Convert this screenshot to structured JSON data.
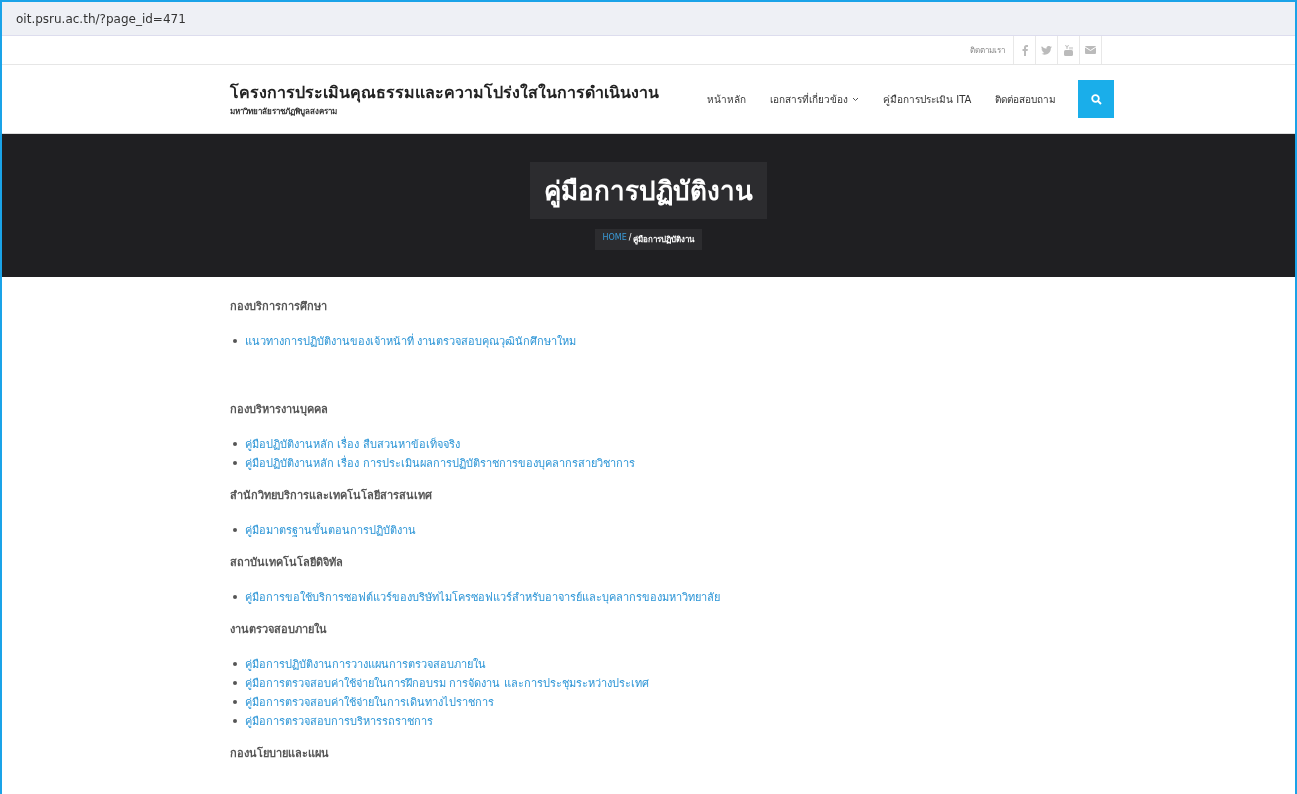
{
  "address_bar": {
    "url": "oit.psru.ac.th/?page_id=471"
  },
  "top_bar": {
    "follow_label": "ติดตามเรา"
  },
  "header": {
    "site_title": "โครงการประเมินคุณธรรมและความโปร่งใสในการดำเนินงาน",
    "site_subtitle": "มหาวิทยาลัยราชภัฏพิบูลสงคราม",
    "nav": [
      {
        "label": "หน้าหลัก",
        "dropdown": false
      },
      {
        "label": "เอกสารที่เกี่ยวข้อง",
        "dropdown": true
      },
      {
        "label": "คู่มือการประเมิน ITA",
        "dropdown": false
      },
      {
        "label": "ติดต่อสอบถาม",
        "dropdown": false
      }
    ]
  },
  "hero": {
    "title": "คู่มือการปฏิบัติงาน",
    "breadcrumb": {
      "home": "HOME",
      "separator": "/",
      "current": "คู่มือการปฏิบัติงาน"
    }
  },
  "sections": [
    {
      "heading": "กองบริการการศึกษา",
      "links": [
        "แนวทางการปฏิบัติงานของเจ้าหน้าที่ งานตรวจสอบคุณวุฒินักศึกษาใหม"
      ]
    },
    {
      "heading": "กองบริหารงานบุคคล",
      "links": [
        "คู่มือปฏิบัติงานหลัก เรื่อง สืบสวนหาข้อเท็จจริง",
        "คู่มือปฏิบัติงานหลัก เรื่อง การประเมินผลการปฏิบัติราชการของบุคลากรสายวิชาการ"
      ]
    },
    {
      "heading": "สำนักวิทยบริการและเทคโนโลยีสารสนเทศ",
      "links": [
        "คู่มือมาตรฐานขั้นตอนการปฏิบัติงาน"
      ]
    },
    {
      "heading": "สถาบันเทคโนโลยีดิจิทัล",
      "links": [
        "คู่มือการขอใช้บริการซอฟต์แวร์ของบริษัทไมโครซอฟแวร์สำหรับอาจารย์และบุคลากรของมหาวิทยาลัย"
      ]
    },
    {
      "heading": "งานตรวจสอบภายใน",
      "links": [
        "คู่มือการปฏิบัติงานการวางแผนการตรวจสอบภายใน",
        "คู่มือการตรวจสอบค่าใช้จ่ายในการฝึกอบรม การจัดงาน และการประชุมระหว่างประเทศ",
        "คู่มือการตรวจสอบค่าใช้จ่ายในการเดินทางไปราชการ",
        "คู่มือการตรวจสอบการบริหารรถราชการ"
      ]
    },
    {
      "heading": "กองนโยบายและแผน"
    }
  ]
}
